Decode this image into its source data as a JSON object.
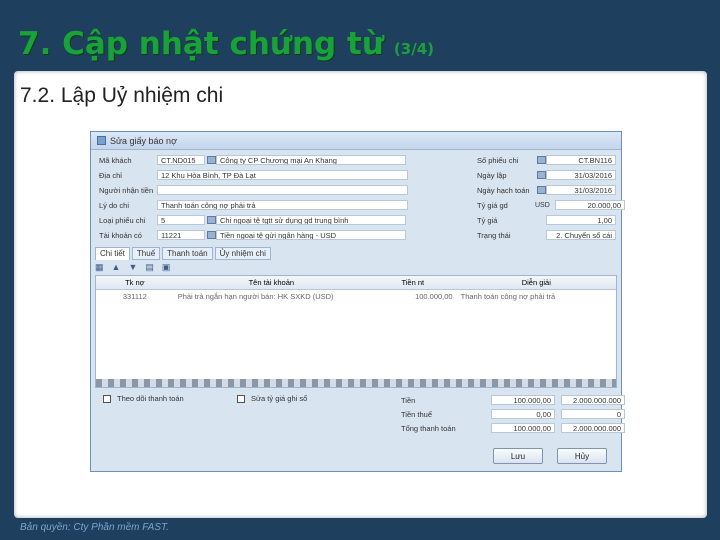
{
  "slide": {
    "title": "7. Cập nhật chứng từ",
    "title_suffix": "(3/4)",
    "heading": "7.2. Lập Uỷ nhiệm chi",
    "copyright": "Bản quyền: Cty Phần mềm FAST."
  },
  "window": {
    "title": "Sửa giấy báo nợ",
    "fields_left": [
      {
        "label": "Mã khách",
        "code": "CT.ND015",
        "value": "Công ty CP Chương mại An Khang"
      },
      {
        "label": "Địa chỉ",
        "code": "",
        "value": "12 Khu Hòa Bình, TP Đà Lạt"
      },
      {
        "label": "Người nhận tiền",
        "code": "",
        "value": ""
      },
      {
        "label": "Lý do chi",
        "code": "",
        "value": "Thanh toán công nợ phải trả"
      },
      {
        "label": "Loại phiếu chi",
        "code": "5",
        "value": "Chi ngoại tệ tgtt sử dụng gd trung bình"
      },
      {
        "label": "Tài khoản có",
        "code": "11221",
        "value": "Tiền ngoại tệ gửi ngân hàng - USD"
      }
    ],
    "fields_right": [
      {
        "label": "Số phiếu chi",
        "value": "CT.BN116"
      },
      {
        "label": "Ngày lập",
        "value": "31/03/2016"
      },
      {
        "label": "Ngày hạch toán",
        "value": "31/03/2016"
      },
      {
        "label": "Tỷ giá gd",
        "currency": "USD",
        "value": "20.000,00"
      },
      {
        "label": "Tỷ giá",
        "value": "1,00"
      },
      {
        "label": "Trạng thái",
        "value": "2. Chuyển sổ cái"
      }
    ],
    "tabs": [
      "Chi tiết",
      "Thuế",
      "Thanh toán",
      "Ủy nhiệm chi"
    ],
    "grid": {
      "columns": [
        "Tk nợ",
        "Tên tài khoản",
        "Tiền nt",
        "Diễn giải"
      ],
      "rows": [
        {
          "tk": "331112",
          "name": "Phải trả ngắn hạn người bán: HK SXKD (USD)",
          "amount": "100.000,00",
          "desc": "Thanh toán công nợ phải trả"
        }
      ]
    },
    "checkbox_follow": "Theo dõi thanh toán",
    "checkbox_rate": "Sửa tỷ giá ghi sổ",
    "totals": [
      {
        "label": "Tiền",
        "nt": "100.000,00",
        "vnd": "2.000.000.000"
      },
      {
        "label": "Tiền thuế",
        "nt": "0,00",
        "vnd": "0"
      },
      {
        "label": "Tổng thanh toán",
        "nt": "100.000,00",
        "vnd": "2.000.000.000"
      }
    ],
    "save_label": "Lưu",
    "cancel_label": "Hủy"
  }
}
